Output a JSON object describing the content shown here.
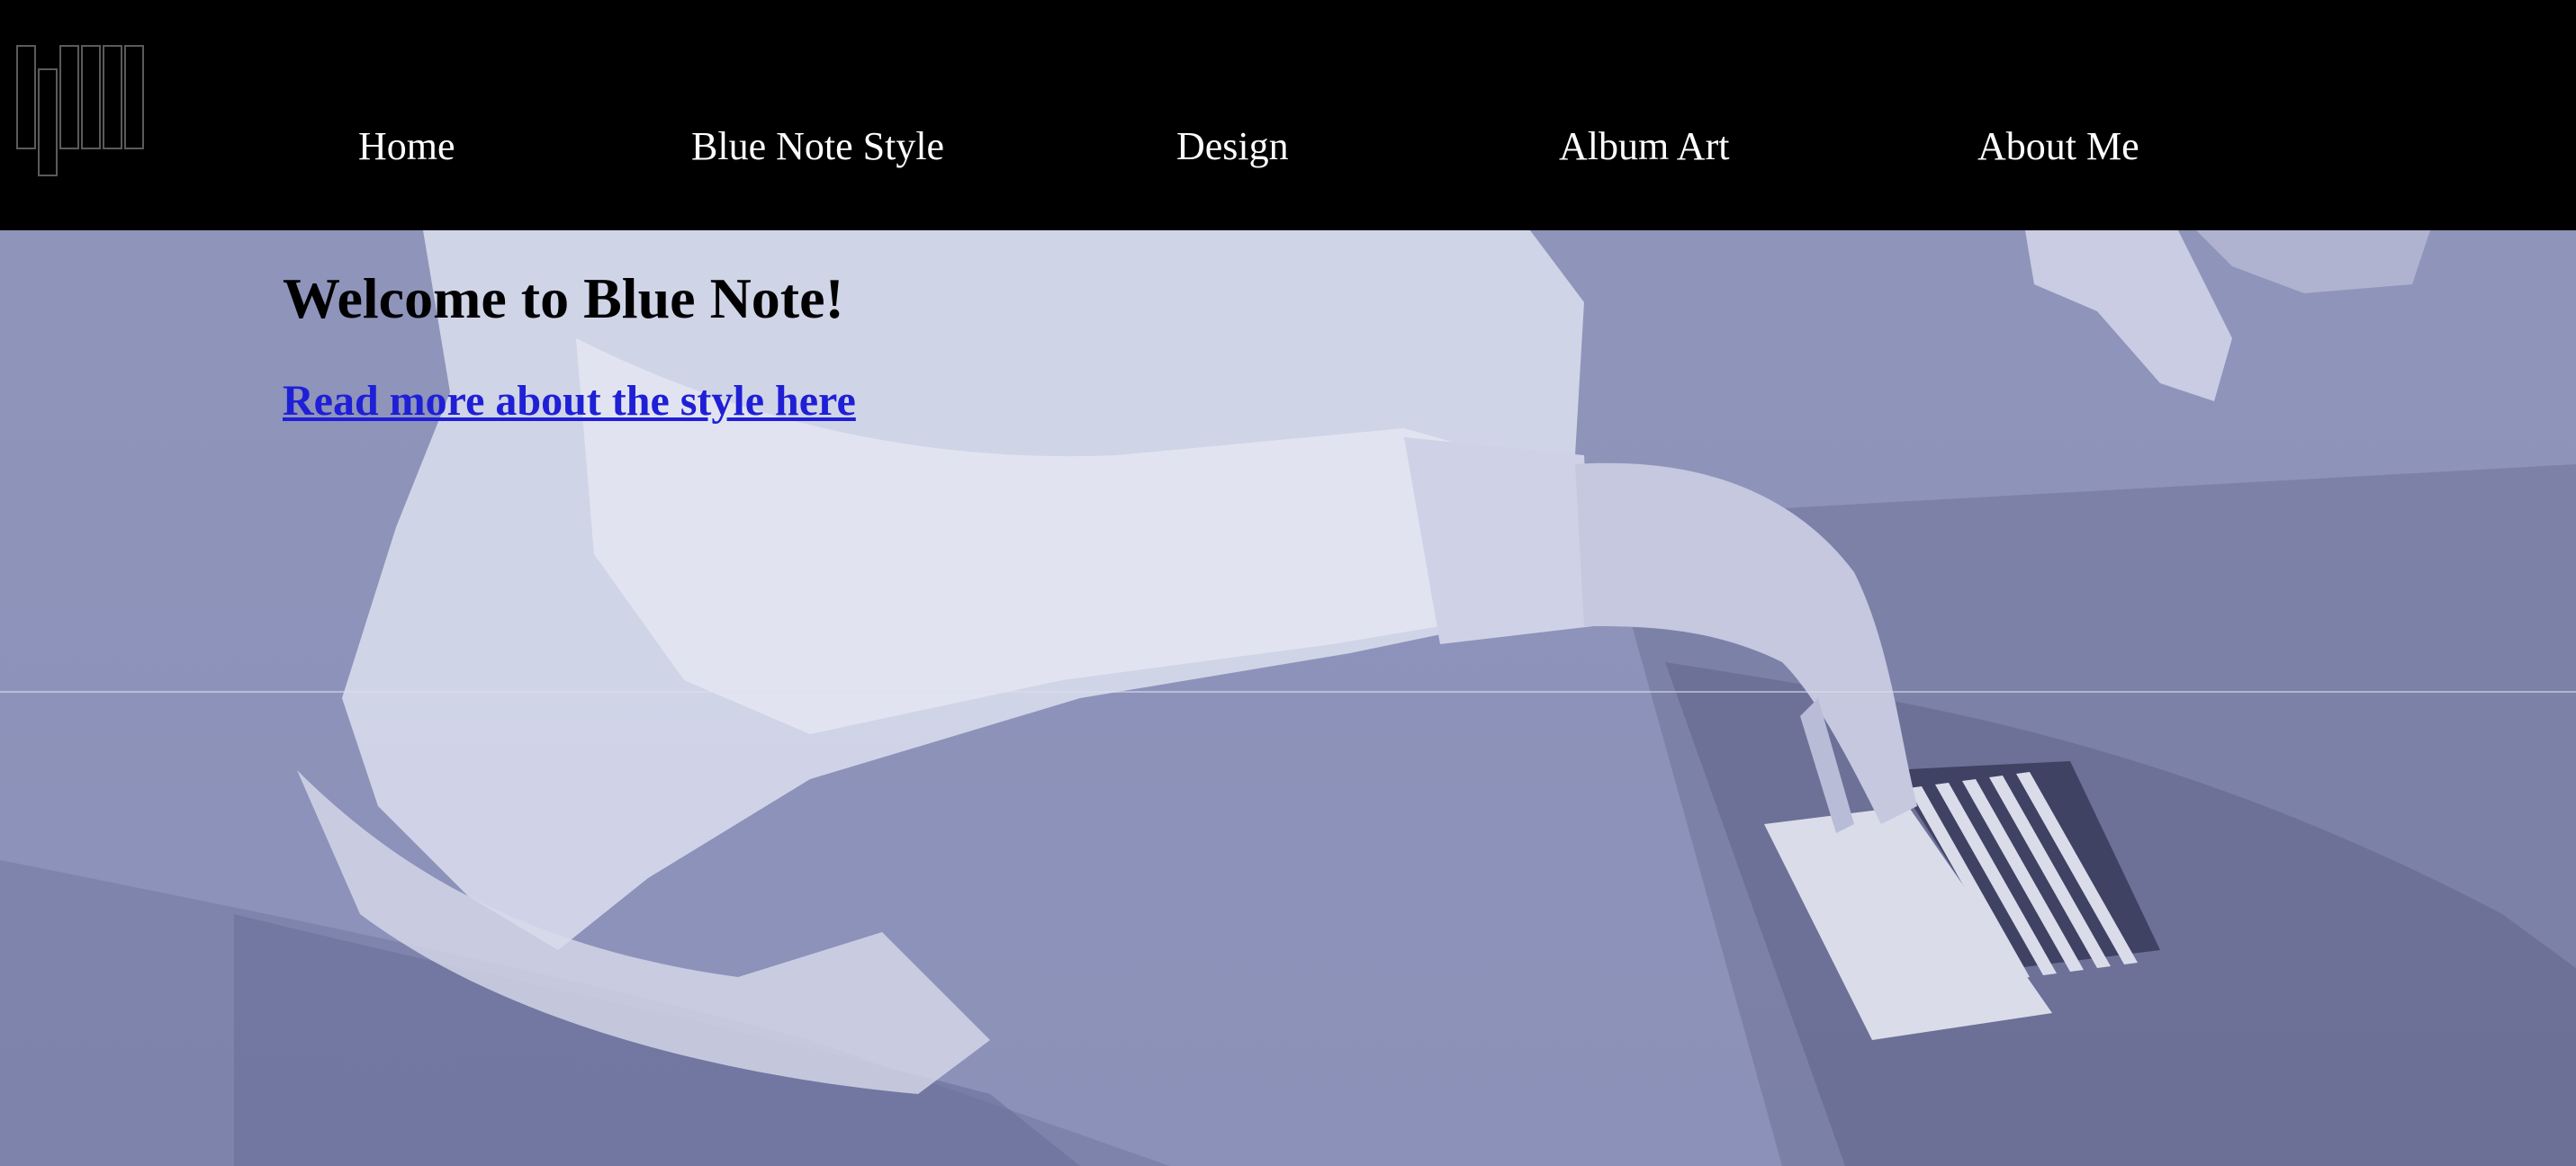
{
  "colors": {
    "navbar_background": "#000000",
    "nav_text": "#ffffff",
    "hero_tint": "#9096bd",
    "heading_text": "#000000",
    "link_text": "#1f1fd6"
  },
  "logo": {
    "icon": "piano-keys-logo-icon"
  },
  "nav": {
    "items": [
      {
        "label": "Home"
      },
      {
        "label": "Blue Note Style"
      },
      {
        "label": "Design"
      },
      {
        "label": "Album Art"
      },
      {
        "label": "About Me"
      }
    ]
  },
  "hero": {
    "image": "blue-tinted-photo-of-pianist-hands-on-piano",
    "heading": "Welcome to Blue Note!",
    "link_label": "Read more about the style here"
  }
}
